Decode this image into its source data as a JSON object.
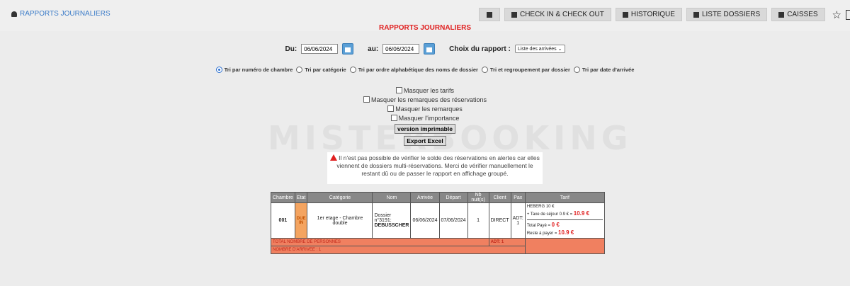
{
  "breadcrumb": "RAPPORTS JOURNALIERS",
  "nav": {
    "checkinout": "CHECK IN & CHECK OUT",
    "historique": "HISTORIQUE",
    "dossiers": "LISTE DOSSIERS",
    "caisses": "CAISSES"
  },
  "title": "RAPPORTS JOURNALIERS",
  "filters": {
    "du_label": "Du:",
    "du_value": "06/06/2024",
    "au_label": "au:",
    "au_value": "06/06/2024",
    "choix_label": "Choix du rapport :",
    "choix_value": "Liste des arrivées"
  },
  "sort_options": [
    "Tri par numéro de chambre",
    "Tri par catégorie",
    "Tri par ordre alphabétique des noms de dossier",
    "Tri et regroupement par dossier",
    "Tri par date d'arrivée"
  ],
  "options": {
    "masquer_tarifs": "Masquer les tarifs",
    "masquer_remarques_res": "Masquer les remarques des réservations",
    "masquer_remarques": "Masquer les remarques",
    "masquer_importance": "Masquer l'importance",
    "version_imprimable": "version imprimable",
    "export_excel": "Export Excel"
  },
  "watermark": "MISTERBOOKING",
  "alert_text": "Il n'est pas possible de vérifier le solde des réservations en alertes car elles viennent de dossiers multi-réservations. Merci de vérifier manuellement le restant dû ou de passer le rapport en affichage groupé.",
  "table": {
    "headers": [
      "Chambre",
      "Etat",
      "Catégorie",
      "Nom",
      "Arrivée",
      "Départ",
      "Nb nuit(s)",
      "Client",
      "Pax",
      "Tarif"
    ],
    "row": {
      "chambre": "001",
      "etat": "DUE IN",
      "categorie": "1er etage - Chambre double",
      "nom_prefix": "Dossier n°3191:",
      "nom": "DEBUSSCHER",
      "arrivee": "06/06/2024",
      "depart": "07/06/2024",
      "nuits": "1",
      "client": "DIRECT",
      "pax": "ADT: 1",
      "tarif_heberg": "HEBERG 10 €",
      "tarif_taxe": "+ Taxe de séjour 0.9 € =",
      "tarif_total": "10.9 €",
      "tarif_paye_label": "Total Payé =",
      "tarif_paye": "0 €",
      "tarif_reste_label": "Reste à payer =",
      "tarif_reste": "10.9 €"
    },
    "total_personnes_label": "TOTAL NOMBRE DE PERSONNES",
    "total_personnes_value": "ADT: 1",
    "nombre_arrivee_label": "NOMBRE D'ARRIVEE : 1"
  }
}
